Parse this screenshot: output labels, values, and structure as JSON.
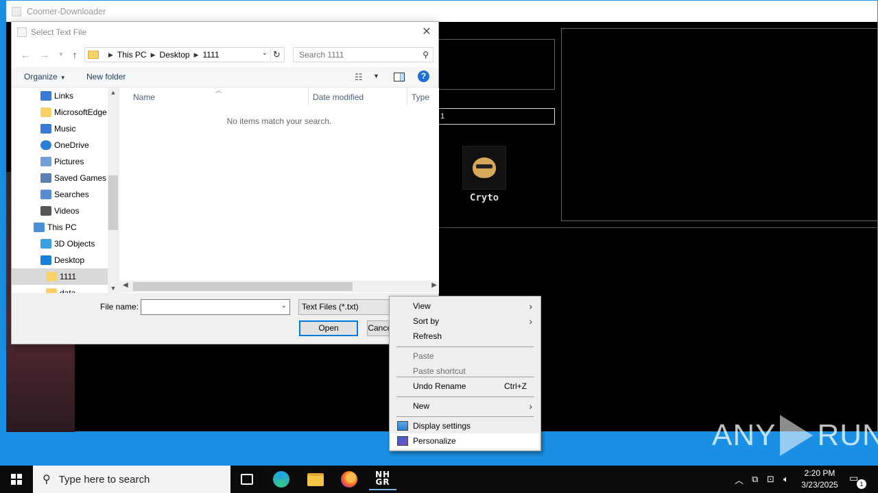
{
  "app": {
    "title": "Coomer-Downloader",
    "input_value": "1",
    "card_label": "Cryto"
  },
  "dialog": {
    "title": "Select Text File",
    "breadcrumb": [
      "This PC",
      "Desktop",
      "1111"
    ],
    "search_placeholder": "Search 1111",
    "toolbar": {
      "organize": "Organize",
      "new_folder": "New folder"
    },
    "tree": [
      {
        "label": "Links",
        "icon": "links-icon",
        "color": "#3a7bd5"
      },
      {
        "label": "MicrosoftEdge",
        "icon": "folder-icon",
        "color": "#f7d26b"
      },
      {
        "label": "Music",
        "icon": "music-icon",
        "color": "#3a7bd5"
      },
      {
        "label": "OneDrive",
        "icon": "cloud-icon",
        "color": "#2b7fd4"
      },
      {
        "label": "Pictures",
        "icon": "pictures-icon",
        "color": "#6f9fd6"
      },
      {
        "label": "Saved Games",
        "icon": "games-icon",
        "color": "#5a7fb0"
      },
      {
        "label": "Searches",
        "icon": "search-icon",
        "color": "#5a8ad0"
      },
      {
        "label": "Videos",
        "icon": "video-icon",
        "color": "#555555"
      },
      {
        "label": "This PC",
        "icon": "computer-icon",
        "color": "#4a90d9"
      },
      {
        "label": "3D Objects",
        "icon": "cube-icon",
        "color": "#3aa0e0"
      },
      {
        "label": "Desktop",
        "icon": "desktop-icon",
        "color": "#1a7fd8"
      },
      {
        "label": "1111",
        "icon": "folder-icon",
        "color": "#f7d26b"
      },
      {
        "label": "data",
        "icon": "folder-icon",
        "color": "#f7d26b"
      }
    ],
    "columns": [
      "Name",
      "Date modified",
      "Type"
    ],
    "empty_message": "No items match your search.",
    "file_name_label": "File name:",
    "file_name_value": "",
    "file_type": "Text Files (*.txt)",
    "open_label": "Open",
    "cancel_label": "Cancel"
  },
  "context_menu": {
    "items": [
      {
        "label": "View",
        "submenu": true,
        "disabled": false
      },
      {
        "label": "Sort by",
        "submenu": true,
        "disabled": false
      },
      {
        "label": "Refresh",
        "submenu": false,
        "disabled": false
      },
      {
        "label": "Paste",
        "submenu": false,
        "disabled": true
      },
      {
        "label": "Paste shortcut",
        "submenu": false,
        "disabled": true
      },
      {
        "label": "Undo Rename",
        "shortcut": "Ctrl+Z",
        "submenu": false,
        "disabled": false
      },
      {
        "label": "New",
        "submenu": true,
        "disabled": false
      },
      {
        "label": "Display settings",
        "icon": "display-icon",
        "submenu": false,
        "disabled": false
      },
      {
        "label": "Personalize",
        "icon": "personalize-icon",
        "submenu": false,
        "disabled": false
      }
    ]
  },
  "watermark": {
    "left": "ANY",
    "right": "RUN"
  },
  "taskbar": {
    "search_placeholder": "Type here to search",
    "time": "2:20 PM",
    "date": "3/23/2025",
    "notification_count": "1",
    "nhgr_line1": "NH",
    "nhgr_line2": "GR"
  }
}
